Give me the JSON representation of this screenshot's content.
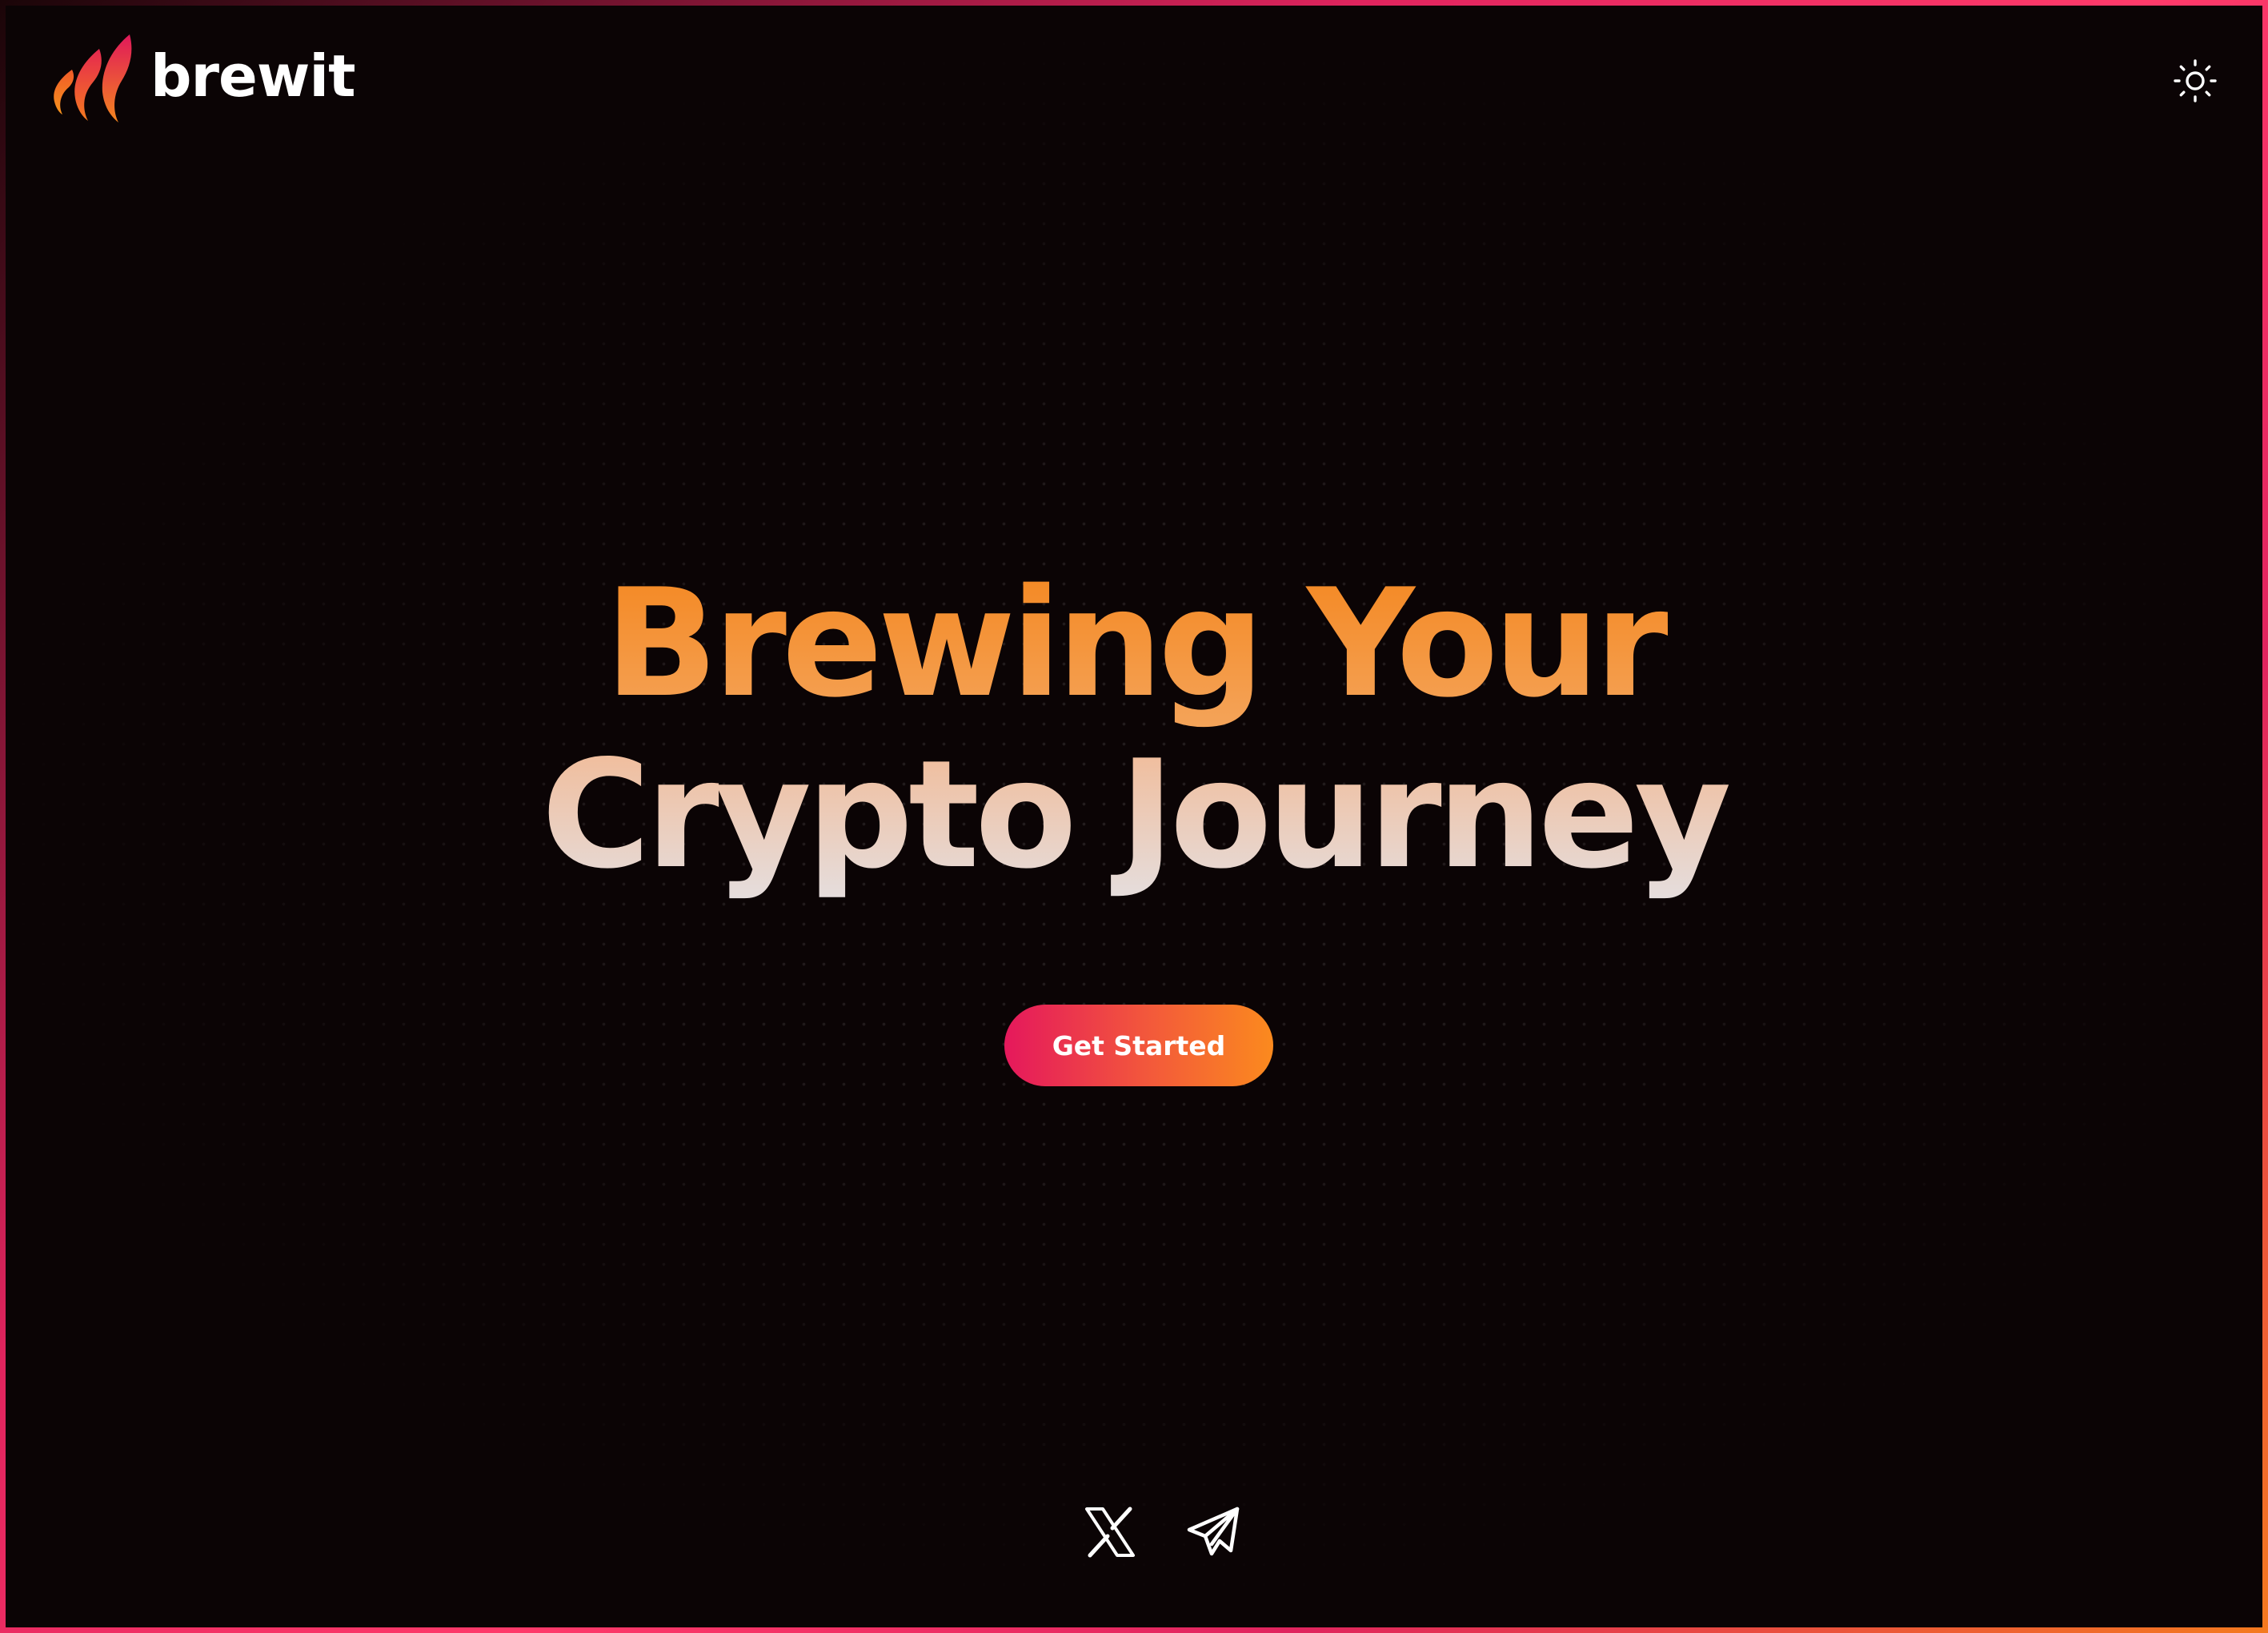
{
  "header": {
    "brand": "brewit",
    "logo_icon": "flame-logo-icon",
    "theme_toggle_icon": "sun-icon"
  },
  "hero": {
    "line1": "Brewing Your",
    "line2": "Crypto Journey",
    "cta_label": "Get Started"
  },
  "social": {
    "icons": [
      "x-twitter-icon",
      "telegram-icon"
    ]
  },
  "colors": {
    "background": "#0b0405",
    "accent_orange": "#f4861e",
    "accent_pink": "#e5185c",
    "text_light": "#e5dede",
    "frame_gradient_start": "#e0245e",
    "frame_gradient_end": "#f47a1f"
  }
}
